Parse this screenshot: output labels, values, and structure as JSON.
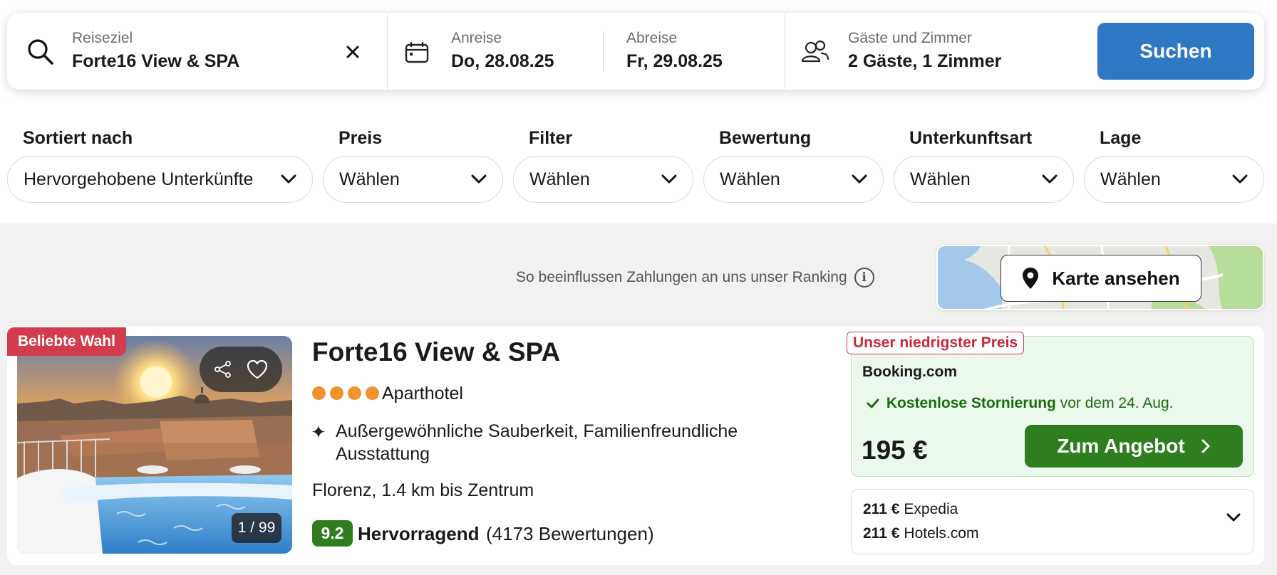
{
  "search": {
    "destination": {
      "label": "Reiseziel",
      "value": "Forte16 View & SPA",
      "clear_icon": "close-icon"
    },
    "checkin": {
      "label": "Anreise",
      "value": "Do, 28.08.25"
    },
    "checkout": {
      "label": "Abreise",
      "value": "Fr, 29.08.25"
    },
    "guests": {
      "label": "Gäste und Zimmer",
      "value": "2 Gäste, 1 Zimmer"
    },
    "search_button": "Suchen"
  },
  "filters": [
    {
      "label": "Sortiert nach",
      "value": "Hervorgehobene Unterkünfte"
    },
    {
      "label": "Preis",
      "value": "Wählen"
    },
    {
      "label": "Filter",
      "value": "Wählen"
    },
    {
      "label": "Bewertung",
      "value": "Wählen"
    },
    {
      "label": "Unterkunftsart",
      "value": "Wählen"
    },
    {
      "label": "Lage",
      "value": "Wählen"
    }
  ],
  "ranking_notice": "So beeinflussen Zahlungen an uns unser Ranking",
  "map_button": "Karte ansehen",
  "result": {
    "badge": "Beliebte Wahl",
    "photo_counter": "1 / 99",
    "name": "Forte16 View & SPA",
    "stars": 4,
    "type": "Aparthotel",
    "features": "Außergewöhnliche Sauberkeit, Familienfreundliche Ausstattung",
    "location": "Florenz, 1.4 km bis Zentrum",
    "score": "9.2",
    "rating_word": "Hervorragend",
    "rating_count": "(4173 Bewertungen)",
    "deal": {
      "tag": "Unser niedrigster Preis",
      "provider": "Booking.com",
      "cancellation": "Kostenlose Stornierung",
      "cancellation_until": "vor dem 24. Aug.",
      "price": "195 €",
      "cta": "Zum Angebot"
    },
    "other_offers": [
      {
        "price": "211 €",
        "provider": "Expedia"
      },
      {
        "price": "211 €",
        "provider": "Hotels.com"
      }
    ]
  },
  "colors": {
    "primary_blue": "#2f78c4",
    "deal_green": "#2e7d1f",
    "badge_red": "#d33c4c",
    "star_orange": "#f0922d"
  }
}
